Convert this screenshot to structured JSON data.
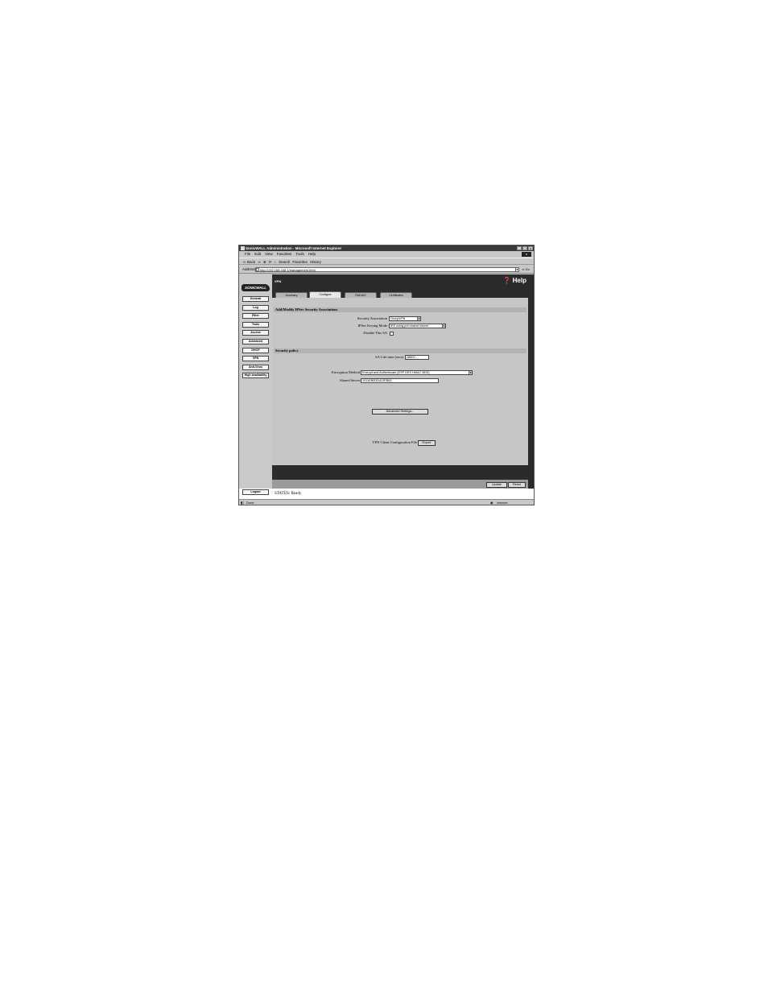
{
  "window": {
    "title": "SonicWALL Administration - Microsoft Internet Explorer",
    "controls": [
      "_",
      "□",
      "×"
    ]
  },
  "menu": [
    "File",
    "Edit",
    "View",
    "Favorites",
    "Tools",
    "Help"
  ],
  "toolbar": {
    "back": "⇐ Back",
    "forward": "⇒",
    "stop": "⊗",
    "refresh": "⟳",
    "home": "⌂",
    "search": "Search",
    "favorites": "Favorites",
    "history": "History"
  },
  "address": {
    "label": "Address",
    "url": "http://192.168.168.1/management.html",
    "go": "Go"
  },
  "sidebar": {
    "logo": "SONICWALL",
    "items": [
      "General",
      "Log",
      "Filter",
      "Tools",
      "Access",
      "Advanced",
      "DHCP",
      "VPN",
      "Anti-Virus",
      "High Availability"
    ],
    "logout": "Logout"
  },
  "header": {
    "section": "VPN",
    "help": "Help"
  },
  "tabs": [
    "Summary",
    "Configure",
    "RADIUS",
    "Certificates"
  ],
  "sa_section": {
    "title": "Add/Modify IPSec Security Associations",
    "security_association_label": "Security Association",
    "security_association_value": "GroupVPN",
    "keying_mode_label": "IPSec Keying Mode",
    "keying_mode_value": "IKE using pre-shared secret",
    "disable_label": "Disable This SA"
  },
  "policy_section": {
    "title": "Security policy",
    "lifetime_label": "SA Life time (secs)",
    "lifetime_value": "28800",
    "encryption_label": "Encryption Method",
    "encryption_value": "Encrypt and Authenticate (ESP DES HMAC MD5)",
    "secret_label": "Shared Secret",
    "secret_value": "1011EB0DD412EB00",
    "advanced_button": "Advanced Settings...",
    "client_config_label": "VPN Client Configuration File",
    "export_button": "Export"
  },
  "footer": {
    "update": "Update",
    "reset": "Reset"
  },
  "status": {
    "text": "STATUS: Ready"
  },
  "ie_status": {
    "left": "Done",
    "zone": "Internet"
  }
}
